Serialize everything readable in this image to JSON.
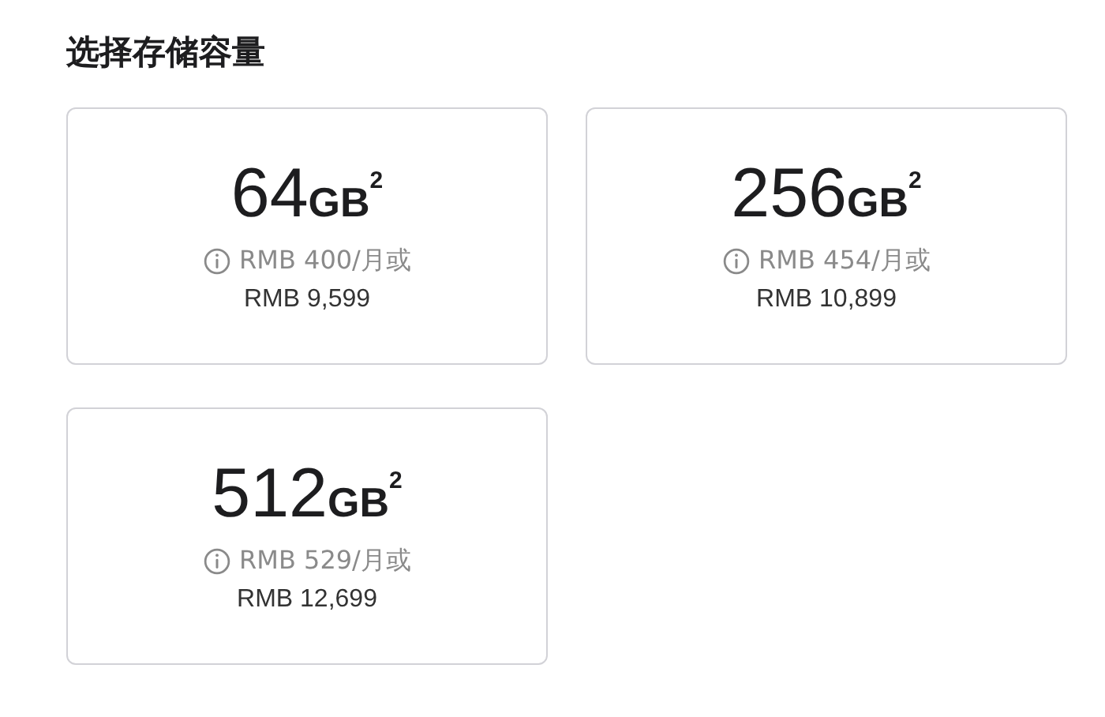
{
  "title": "选择存储容量",
  "options": [
    {
      "size": "64",
      "unit": "GB",
      "note": "2",
      "monthly": "RMB 400/月或",
      "price": "RMB 9,599"
    },
    {
      "size": "256",
      "unit": "GB",
      "note": "2",
      "monthly": "RMB 454/月或",
      "price": "RMB 10,899"
    },
    {
      "size": "512",
      "unit": "GB",
      "note": "2",
      "monthly": "RMB 529/月或",
      "price": "RMB 12,699"
    }
  ]
}
